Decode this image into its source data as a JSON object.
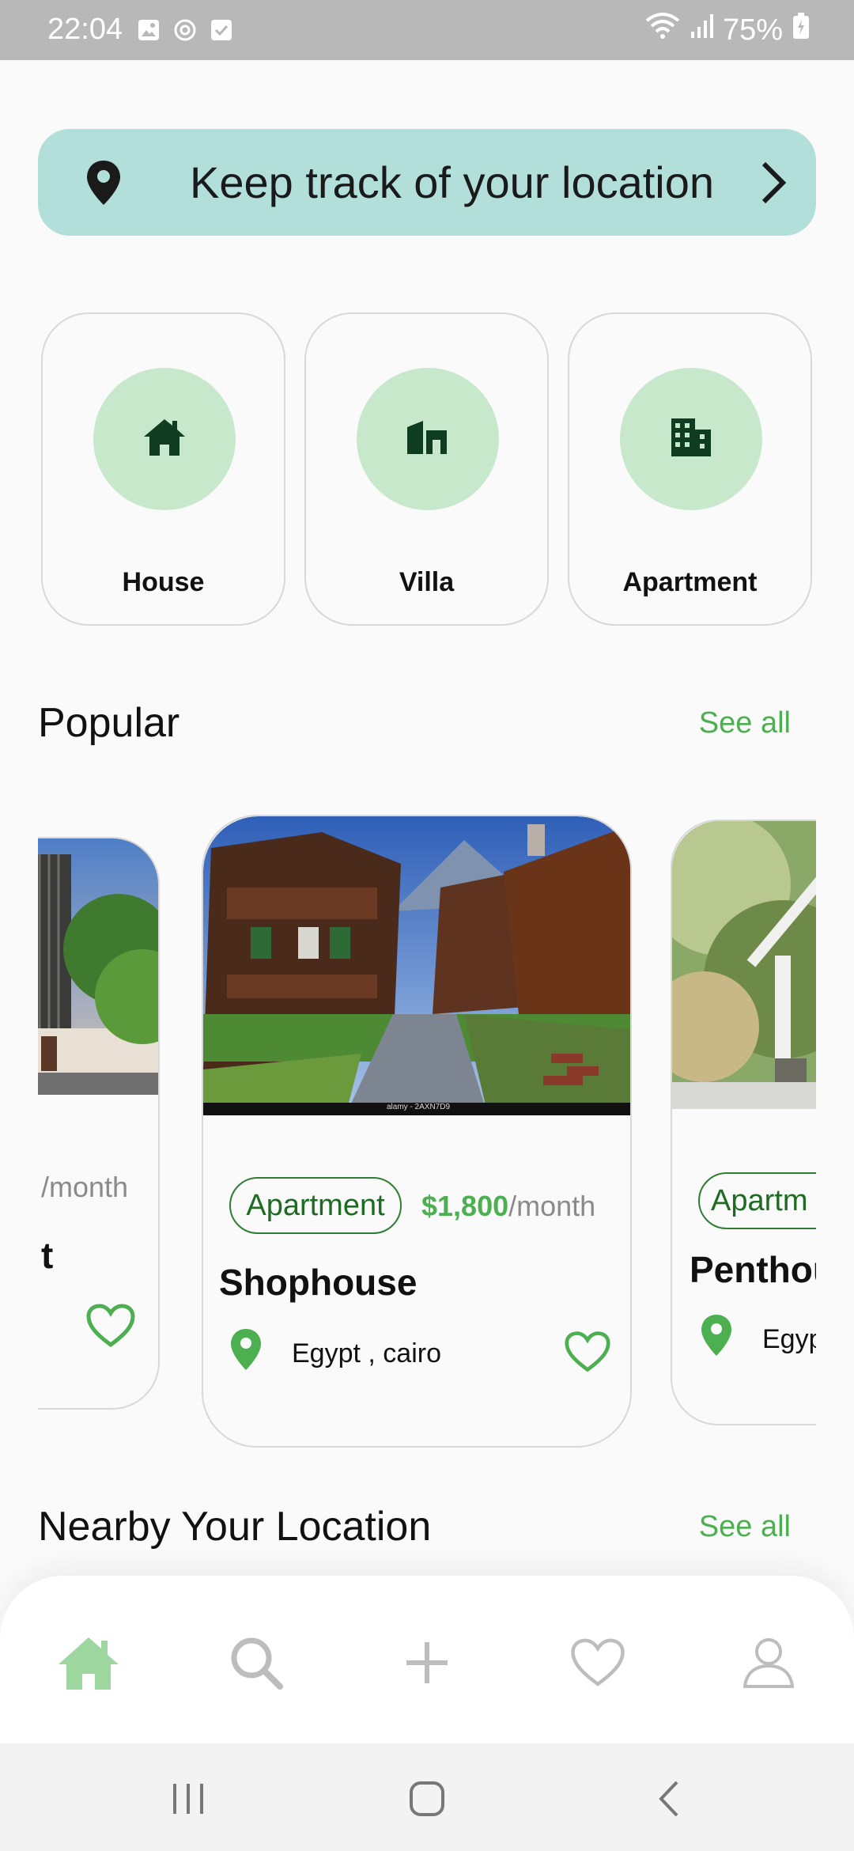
{
  "status_bar": {
    "time": "22:04",
    "left_icons": [
      "image-icon",
      "sync-icon",
      "check-box-icon"
    ],
    "battery": "75%",
    "right_icons": [
      "wifi-icon",
      "signal-icon",
      "battery-icon"
    ]
  },
  "location_banner": {
    "text": "Keep track of your location",
    "icons": [
      "location-pin-icon",
      "chevron-right-icon"
    ]
  },
  "categories": [
    {
      "label": "House",
      "icon": "house-icon"
    },
    {
      "label": "Villa",
      "icon": "villa-icon"
    },
    {
      "label": "Apartment",
      "icon": "apartment-building-icon"
    }
  ],
  "popular": {
    "title": "Popular",
    "see_all": "See all",
    "cards": [
      {
        "price_suffix": "/month",
        "name_tail": "t"
      },
      {
        "type": "Apartment",
        "price": "$1,800",
        "price_suffix": "/month",
        "name": "Shophouse",
        "location": "Egypt , cairo",
        "image_caption": "alamy - 2AXN7D9"
      },
      {
        "type": "Apartm",
        "name": "Penthou",
        "location": "Egyp"
      }
    ]
  },
  "nearby": {
    "title": "Nearby Your Location",
    "see_all": "See all"
  },
  "bottom_nav": [
    "home-icon",
    "search-icon",
    "add-icon",
    "heart-icon",
    "profile-icon"
  ],
  "colors": {
    "accent_green": "#4caf50",
    "dark_green": "#1e6b23",
    "banner_bg": "#b3dfdb",
    "category_circle": "#c8e8cc"
  }
}
